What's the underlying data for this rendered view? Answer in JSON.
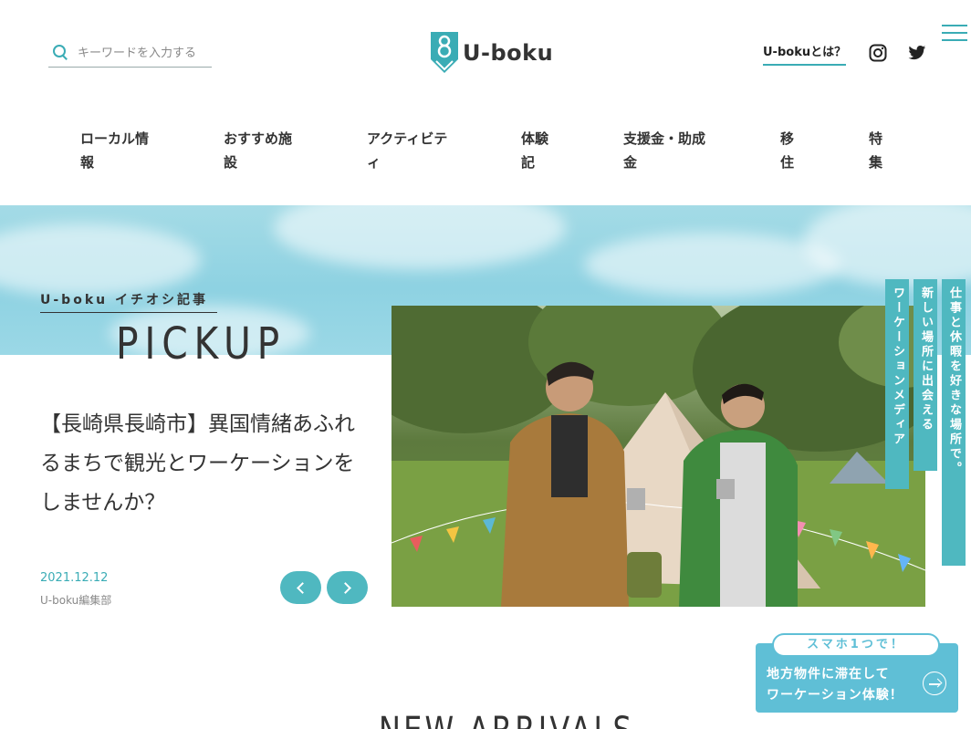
{
  "header": {
    "search": {
      "placeholder": "キーワードを入力する",
      "icon": "search-icon"
    },
    "logo_text": "U-boku",
    "about_link": "U-bokuとは？",
    "social": [
      "instagram-icon",
      "twitter-icon"
    ],
    "menu_icon": "hamburger-icon",
    "accent_color": "#3aacb5"
  },
  "nav": {
    "items": [
      {
        "line1": "ローカル情",
        "line2": "報"
      },
      {
        "line1": "おすすめ施",
        "line2": "設"
      },
      {
        "line1": "アクティビテ",
        "line2": "ィ"
      },
      {
        "line1": "体験",
        "line2": "記"
      },
      {
        "line1": "支援金・助成",
        "line2": "金"
      },
      {
        "line1": "移",
        "line2": "住"
      },
      {
        "line1": "特",
        "line2": "集"
      }
    ]
  },
  "pickup": {
    "label": "U-boku イチオシ記事",
    "title": "PICKUP",
    "article_title": "【長崎県長崎市】異国情緒あふれるまちで観光とワーケーションをしませんか？",
    "date": "2021.12.12",
    "author": "U-boku編集部"
  },
  "vertical_tags": [
    "仕事と休暇を好きな場所で。",
    "新しい場所に出会える",
    "ワーケーションメディア"
  ],
  "promo": {
    "badge": "スマホ1つで！",
    "line1": "地方物件に滞在して",
    "line2": "ワーケーション体験！"
  },
  "section_title": "NEW ARRIVALS"
}
